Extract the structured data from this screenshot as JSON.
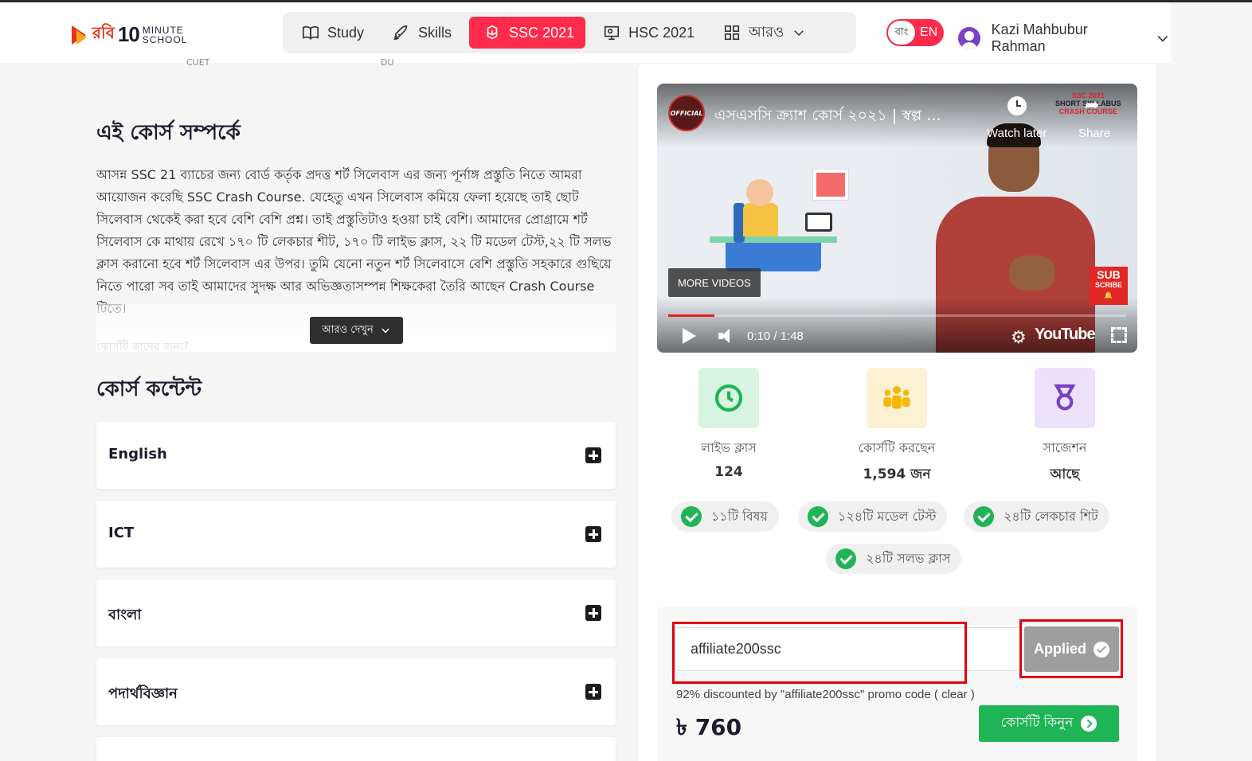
{
  "header": {
    "logo": {
      "robi": "রবি",
      "ten": "10",
      "minute": "MINUTE",
      "school": "SCHOOL"
    },
    "nav": [
      {
        "label": "Study",
        "icon": "book-icon"
      },
      {
        "label": "Skills",
        "icon": "rocket-icon"
      },
      {
        "label": "SSC 2021",
        "icon": "atom-icon",
        "active": true
      },
      {
        "label": "HSC 2021",
        "icon": "board-icon"
      },
      {
        "label": "আরও",
        "icon": "grid-icon"
      }
    ],
    "lang": {
      "bn": "বাং",
      "en": "EN"
    },
    "user": {
      "name": "Kazi Mahbubur Rahman"
    }
  },
  "cut_labels": {
    "left": "CUET",
    "right": "DU"
  },
  "about": {
    "title": "এই কোর্স সম্পর্কে",
    "text": "আসন্ন SSC 21 ব্যাচের জন্য বোর্ড কর্তৃক প্রদত্ত শর্ট সিলেবাস এর জন্য পূর্নাঙ্গ প্রস্তুতি নিতে আমরা আয়োজন করেছি SSC Crash Course. যেহেতু এখন সিলেবাস কমিয়ে ফেলা হয়েছে তাই ছোট সিলেবাস থেকেই করা হবে বেশি বেশি প্রশ্ন। তাই প্রস্তুতিটাও হওয়া চাই বেশি। আমাদের প্রোগ্রামে শর্ট সিলেবাস কে মাথায় রেখে ১৭০ টি লেকচার শীট, ১৭০ টি লাইভ ক্লাস, ২২ টি মডেল টেস্ট,২২ টি সলভ ক্লাস করানো হবে শর্ট সিলেবাস এর উপর। তুমি যেনো নতুন শর্ট সিলেবাসে বেশি প্রস্তুতি সহকারে গুছিয়ে নিতে পারো সব তাই আমাদের সুদক্ষ আর অভিজ্ঞতাসম্পন্ন শিক্ষকেরা তৈরি আছেন Crash Course টিতে।",
    "hidden_line": "কোর্সটি কাদের জন্য?",
    "see_more": "আরও দেখুন"
  },
  "content": {
    "title": "কোর্স কন্টেন্ট",
    "subjects": [
      "English",
      "ICT",
      "বাংলা",
      "পদার্থবিজ্ঞান"
    ]
  },
  "video": {
    "channel": "OFFICIAL",
    "title": "এসএসসি ক্র্যাশ কোর্স ২০২১ | স্বল্প ...",
    "watch_later": "Watch later",
    "share": "Share",
    "badge": {
      "line1": "SSC 2021",
      "line2": "SHORT SYLLABUS",
      "line3": "CRASH COURSE"
    },
    "more_videos": "MORE VIDEOS",
    "subscribe": {
      "top": "SUB",
      "bottom": "SCRIBE"
    },
    "time": "0:10 / 1:48",
    "progress": 0.1,
    "brand": "YouTube"
  },
  "stats": [
    {
      "label": "লাইভ ক্লাস",
      "value": "124",
      "icon": "clock-icon",
      "bg": "#d8f5e3",
      "color": "#1fb456"
    },
    {
      "label": "কোর্সটি করছেন",
      "value": "1,594 জন",
      "icon": "people-icon",
      "bg": "#fdf1d4",
      "color": "#f5b800"
    },
    {
      "label": "সাজেশন",
      "value": "আছে",
      "icon": "medal-icon",
      "bg": "#ece2fb",
      "color": "#7c3fc7"
    }
  ],
  "features": [
    "১১টি বিষয়",
    "১২৪টি মডেল টেস্ট",
    "২৪টি লেকচার শিট",
    "২৪টি সলভ ক্লাস"
  ],
  "promo": {
    "code": "affiliate200ssc",
    "applied_label": "Applied",
    "note": "92% discounted by \"affiliate200ssc\" promo code",
    "clear": "( clear )",
    "price": "৳ 760",
    "buy_label": "কোর্সটি কিনুন"
  }
}
